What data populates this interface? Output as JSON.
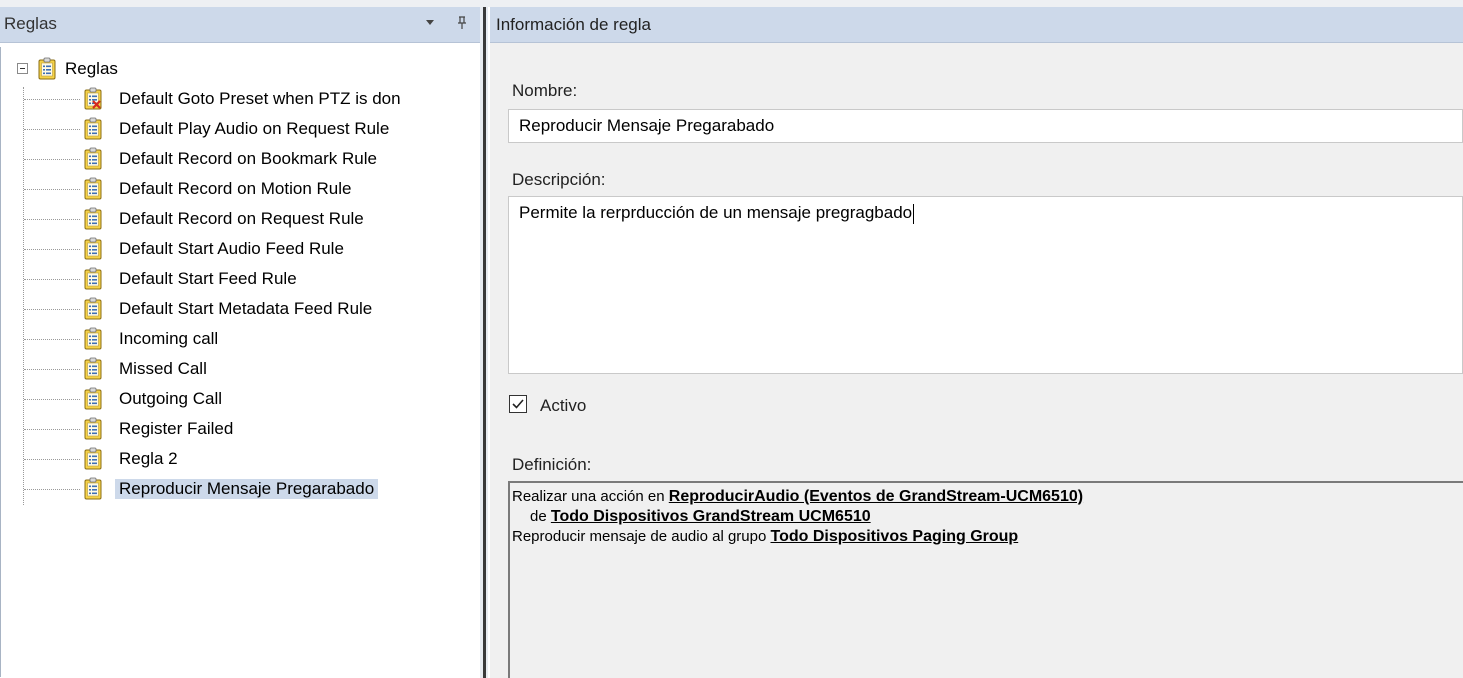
{
  "left_pane": {
    "title": "Reglas",
    "dropdown_glyph": "▾",
    "pin_glyph": "⊥",
    "root_label": "Reglas",
    "items": [
      {
        "label": "Default Goto Preset when PTZ is don",
        "icon": "rule-disabled-icon",
        "selected": false
      },
      {
        "label": "Default Play Audio on Request Rule",
        "icon": "rule-icon",
        "selected": false
      },
      {
        "label": "Default Record on Bookmark Rule",
        "icon": "rule-icon",
        "selected": false
      },
      {
        "label": "Default Record on Motion Rule",
        "icon": "rule-icon",
        "selected": false
      },
      {
        "label": "Default Record on Request Rule",
        "icon": "rule-icon",
        "selected": false
      },
      {
        "label": "Default Start Audio Feed Rule",
        "icon": "rule-icon",
        "selected": false
      },
      {
        "label": "Default Start Feed Rule",
        "icon": "rule-icon",
        "selected": false
      },
      {
        "label": "Default Start Metadata Feed Rule",
        "icon": "rule-icon",
        "selected": false
      },
      {
        "label": "Incoming call",
        "icon": "rule-icon",
        "selected": false
      },
      {
        "label": "Missed Call",
        "icon": "rule-icon",
        "selected": false
      },
      {
        "label": "Outgoing Call",
        "icon": "rule-icon",
        "selected": false
      },
      {
        "label": "Register Failed",
        "icon": "rule-icon",
        "selected": false
      },
      {
        "label": "Regla 2",
        "icon": "rule-icon",
        "selected": false
      },
      {
        "label": "Reproducir Mensaje Pregarabado",
        "icon": "rule-icon",
        "selected": true
      }
    ]
  },
  "right_pane": {
    "title": "Información de regla",
    "name_label": "Nombre:",
    "name_value": "Reproducir Mensaje Pregarabado",
    "description_label": "Descripción:",
    "description_value": "Permite la rerprducción de un mensaje pregragbado",
    "active_label": "Activo",
    "active_checked": true,
    "definition_label": "Definición:",
    "definition": {
      "line1_prefix": "Realizar una acción en ",
      "line1_link": "ReproducirAudio (Eventos de GrandStream-UCM6510)",
      "line2_prefix": "de ",
      "line2_link": "Todo Dispositivos GrandStream UCM6510",
      "line3_prefix": "Reproducir mensaje de audio al grupo ",
      "line3_link": "Todo Dispositivos Paging Group"
    }
  },
  "colors": {
    "header_bg": "#cdd9ea",
    "selection_bg": "#cdd9ea",
    "panel_bg": "#f0f0f0",
    "icon_yellow": "#f5d247",
    "icon_blue": "#3d6fb6",
    "disabled_x": "#d62a1e"
  }
}
